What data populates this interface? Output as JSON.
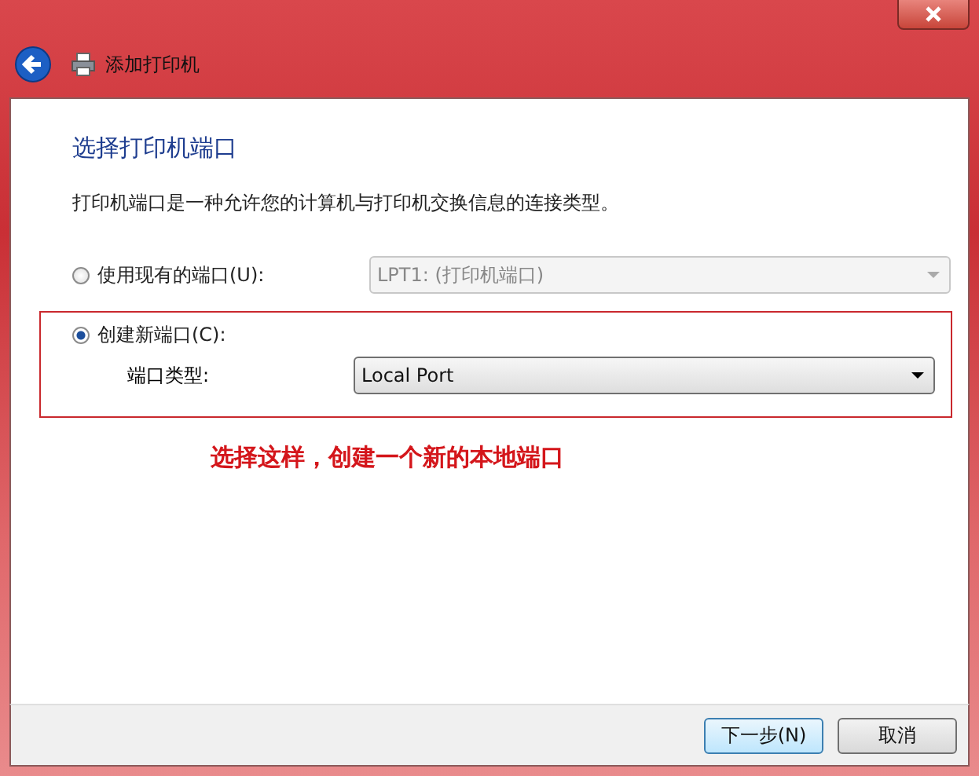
{
  "window": {
    "title": "添加打印机"
  },
  "heading": "选择打印机端口",
  "description": "打印机端口是一种允许您的计算机与打印机交换信息的连接类型。",
  "options": [
    {
      "label": "使用现有的端口(U):",
      "selected": false,
      "dropdown": {
        "value": "LPT1: (打印机端口)",
        "disabled": true
      }
    },
    {
      "label": "创建新端口(C):",
      "selected": true,
      "sub_label": "端口类型:",
      "dropdown": {
        "value": "Local Port",
        "disabled": false
      }
    }
  ],
  "annotation": "选择这样，创建一个新的本地端口",
  "buttons": [
    {
      "label": "下一步(N)",
      "default": true
    },
    {
      "label": "取消",
      "default": false
    }
  ]
}
